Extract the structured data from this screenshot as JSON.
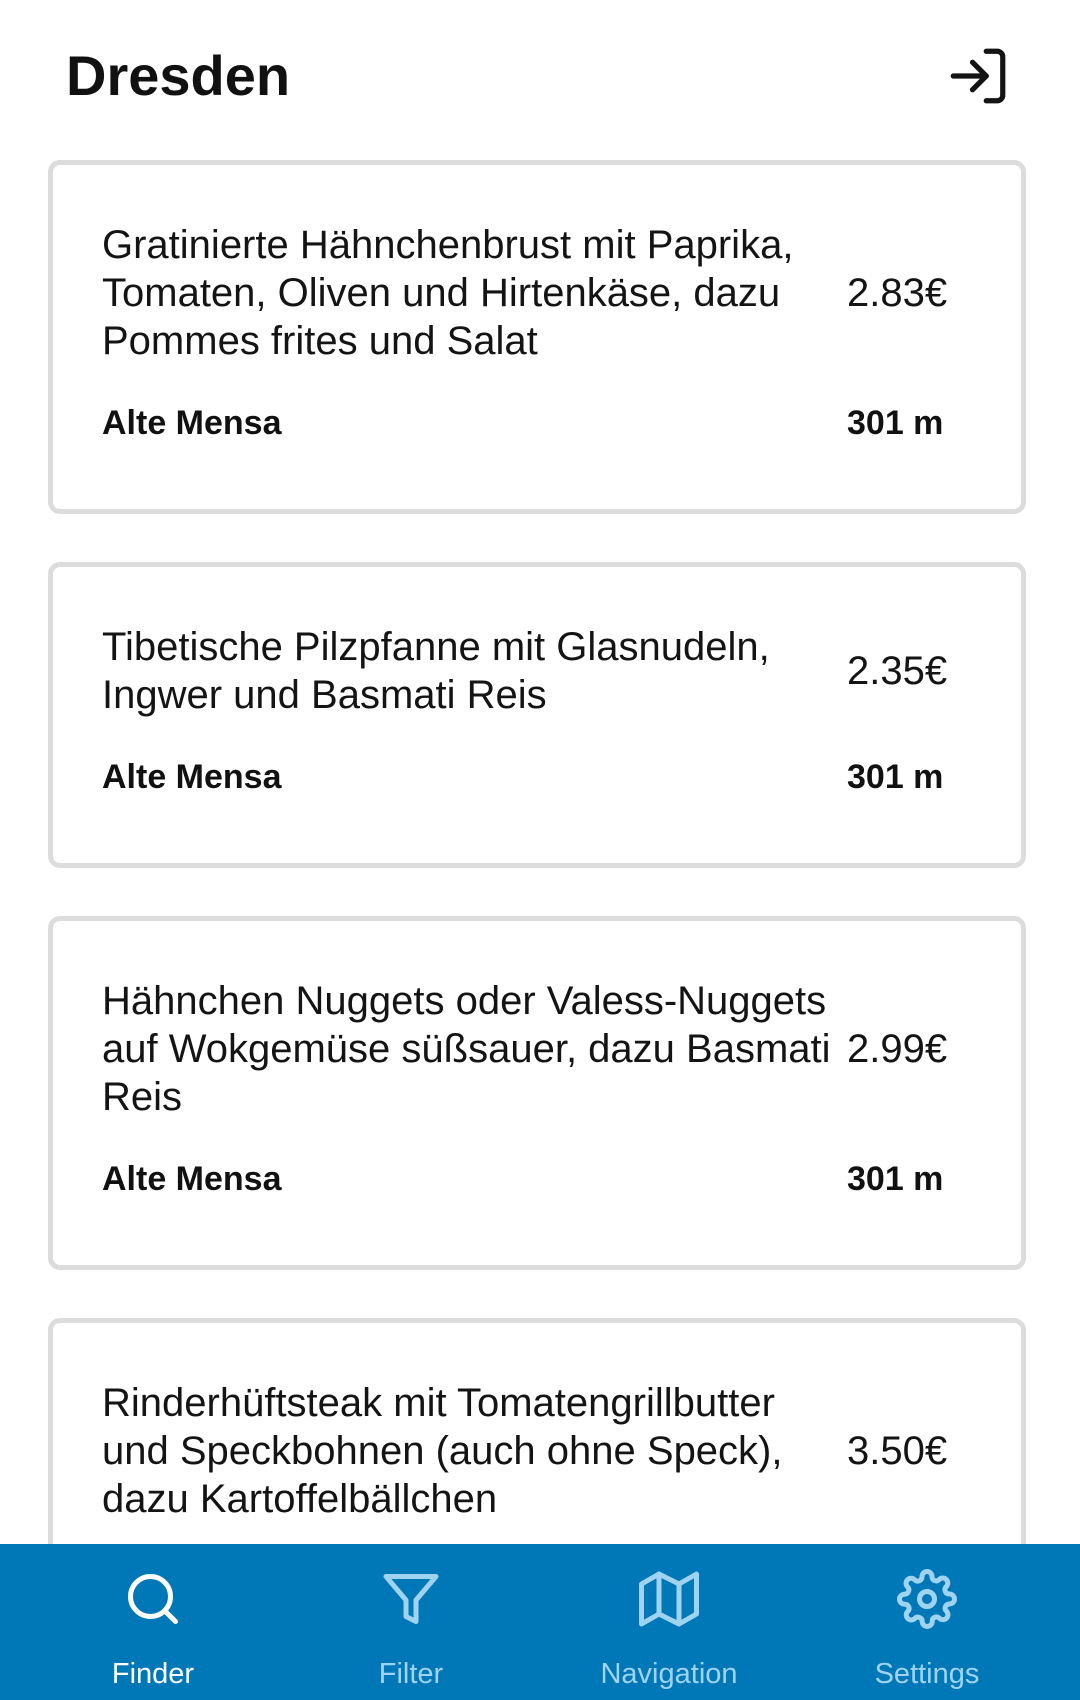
{
  "header": {
    "title": "Dresden",
    "login_icon": "login-icon"
  },
  "meals": [
    {
      "name": "Gratinierte Hähnchenbrust mit Paprika, Tomaten, Oliven und Hirtenkäse, dazu Pommes frites und Salat",
      "price": "2.83€",
      "canteen": "Alte Mensa",
      "distance": "301 m"
    },
    {
      "name": "Tibetische Pilzpfanne mit Glasnudeln, Ingwer und Basmati Reis",
      "price": "2.35€",
      "canteen": "Alte Mensa",
      "distance": "301 m"
    },
    {
      "name": "Hähnchen Nuggets oder Valess-Nuggets auf Wokgemüse süßsauer, dazu Basmati Reis",
      "price": "2.99€",
      "canteen": "Alte Mensa",
      "distance": "301 m"
    },
    {
      "name": "Rinderhüftsteak mit Tomatengrillbutter und Speckbohnen (auch ohne Speck), dazu Kartoffelbällchen",
      "price": "3.50€",
      "canteen": "",
      "distance": ""
    }
  ],
  "nav": {
    "items": [
      {
        "label": "Finder",
        "icon": "search-icon",
        "active": true
      },
      {
        "label": "Filter",
        "icon": "filter-icon",
        "active": false
      },
      {
        "label": "Navigation",
        "icon": "map-icon",
        "active": false
      },
      {
        "label": "Settings",
        "icon": "gear-icon",
        "active": false
      }
    ],
    "colors": {
      "background": "#0077b6",
      "active": "#ffffff",
      "inactive": "#9fd3f0"
    }
  }
}
